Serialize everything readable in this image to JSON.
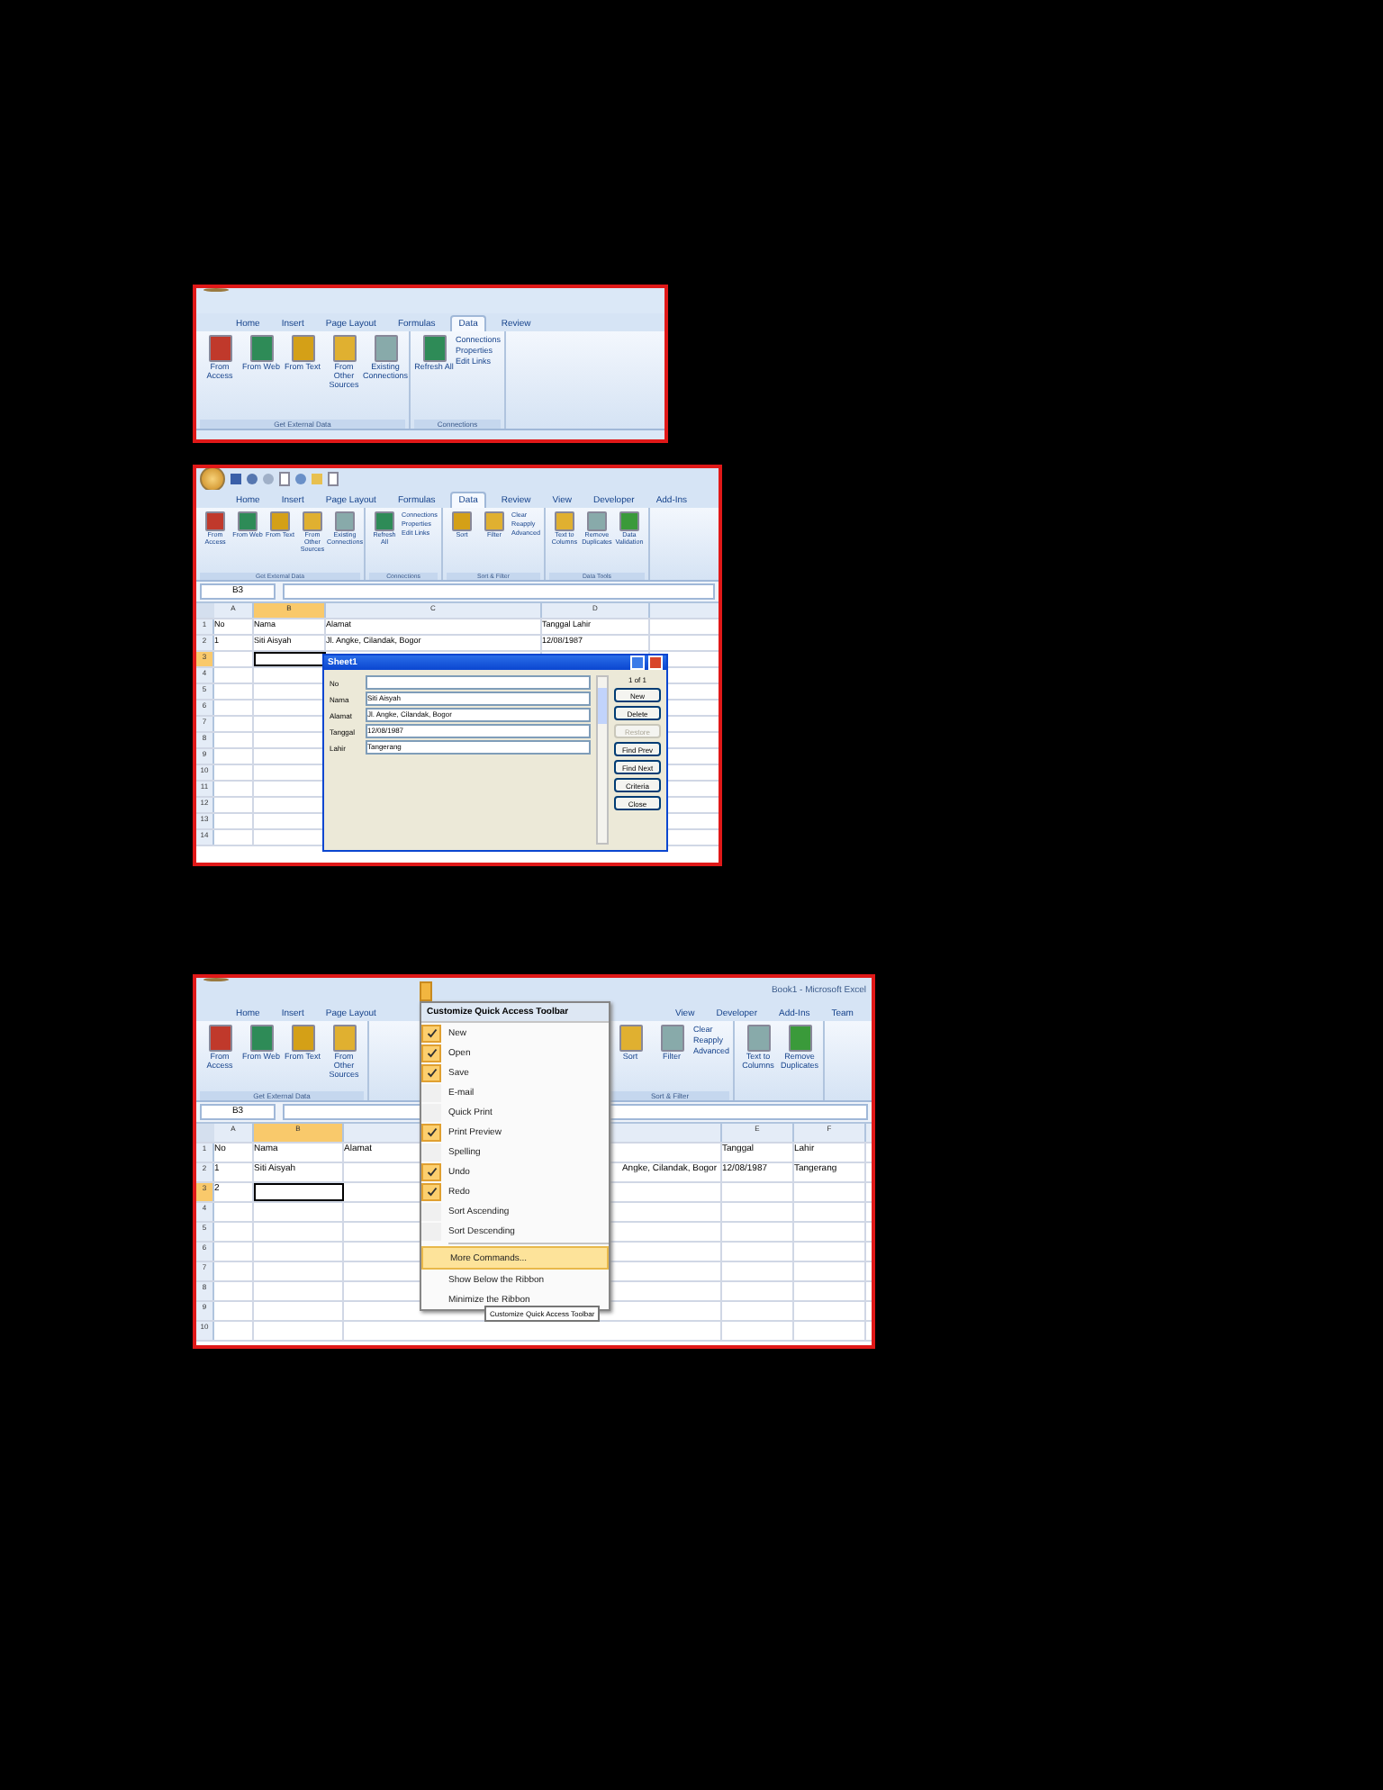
{
  "ribbon_shot": {
    "tabs": [
      {
        "label": "Home",
        "selected": false
      },
      {
        "label": "Insert",
        "selected": false
      },
      {
        "label": "Page Layout",
        "selected": false
      },
      {
        "label": "Formulas",
        "selected": false
      },
      {
        "label": "Data",
        "selected": true
      },
      {
        "label": "Review",
        "selected": false
      }
    ],
    "groups": [
      {
        "label": "Get External Data",
        "buttons": [
          "From Access",
          "From Web",
          "From Text",
          "From Other Sources",
          "Existing Connections"
        ]
      },
      {
        "label": "Connections",
        "buttons": [
          "Refresh All"
        ],
        "small": [
          "Connections",
          "Properties",
          "Edit Links"
        ]
      }
    ]
  },
  "form_shot": {
    "tabs": [
      {
        "label": "Home",
        "selected": false
      },
      {
        "label": "Insert",
        "selected": false
      },
      {
        "label": "Page Layout",
        "selected": false
      },
      {
        "label": "Formulas",
        "selected": false
      },
      {
        "label": "Data",
        "selected": true
      },
      {
        "label": "Review",
        "selected": false
      },
      {
        "label": "View",
        "selected": false
      },
      {
        "label": "Developer",
        "selected": false
      },
      {
        "label": "Add-Ins",
        "selected": false
      }
    ],
    "groups": [
      {
        "label": "Get External Data",
        "buttons": [
          "From Access",
          "From Web",
          "From Text",
          "From Other Sources",
          "Existing Connections"
        ]
      },
      {
        "label": "Connections",
        "buttons": [
          "Refresh All"
        ],
        "small": [
          "Connections",
          "Properties",
          "Edit Links"
        ]
      },
      {
        "label": "Sort & Filter",
        "buttons": [
          "Sort",
          "Filter"
        ],
        "small": [
          "Clear",
          "Reapply",
          "Advanced"
        ]
      },
      {
        "label": "Data Tools",
        "buttons": [
          "Text to Columns",
          "Remove Duplicates",
          "Data Validation"
        ]
      }
    ],
    "name_box": "B3",
    "columns": [
      {
        "label": "A",
        "selected": false
      },
      {
        "label": "B",
        "selected": true
      },
      {
        "label": "C",
        "selected": false
      },
      {
        "label": "D",
        "selected": false
      }
    ],
    "rows": [
      {
        "header": "1",
        "selected": false,
        "cells": [
          "No",
          "Nama",
          "Alamat",
          "Tanggal Lahir"
        ]
      },
      {
        "header": "2",
        "selected": false,
        "cells": [
          "1",
          "Siti Aisyah",
          "Jl. Angke, Cilandak, Bogor",
          "12/08/1987"
        ]
      },
      {
        "header": "3",
        "selected": true,
        "cells": [
          null,
          null,
          null,
          null
        ]
      },
      {
        "header": "4",
        "selected": false,
        "cells": [
          null,
          null,
          null,
          null
        ]
      },
      {
        "header": "5",
        "selected": false,
        "cells": [
          null,
          null,
          null,
          null
        ]
      },
      {
        "header": "6",
        "selected": false,
        "cells": [
          null,
          null,
          null,
          null
        ]
      },
      {
        "header": "7",
        "selected": false,
        "cells": [
          null,
          null,
          null,
          null
        ]
      },
      {
        "header": "8",
        "selected": false,
        "cells": [
          null,
          null,
          null,
          null
        ]
      },
      {
        "header": "9",
        "selected": false,
        "cells": [
          null,
          null,
          null,
          null
        ]
      },
      {
        "header": "10",
        "selected": false,
        "cells": [
          null,
          null,
          null,
          null
        ]
      },
      {
        "header": "11",
        "selected": false,
        "cells": [
          null,
          null,
          null,
          null
        ]
      },
      {
        "header": "12",
        "selected": false,
        "cells": [
          null,
          null,
          null,
          null
        ]
      },
      {
        "header": "13",
        "selected": false,
        "cells": [
          null,
          null,
          null,
          null
        ]
      },
      {
        "header": "14",
        "selected": false,
        "cells": [
          null,
          null,
          null,
          null
        ]
      }
    ],
    "dialog": {
      "title": "Sheet1",
      "record": "1 of 1",
      "fields": [
        {
          "label": "No"
        },
        {
          "label": "Nama",
          "value": "Siti Aisyah"
        },
        {
          "label": "Alamat",
          "value": "Jl. Angke, Cilandak, Bogor"
        },
        {
          "label": "Tanggal",
          "value": "12/08/1987"
        },
        {
          "label": "Lahir",
          "value": "Tangerang"
        }
      ],
      "buttons": [
        {
          "label": "New",
          "disabled": false
        },
        {
          "label": "Delete",
          "disabled": false
        },
        {
          "label": "Restore",
          "disabled": true
        },
        {
          "label": "Find Prev",
          "disabled": false
        },
        {
          "label": "Find Next",
          "disabled": false
        },
        {
          "label": "Criteria",
          "disabled": false
        },
        {
          "label": "Close",
          "disabled": false
        }
      ]
    }
  },
  "menu_shot": {
    "window_title": "Book1 - Microsoft Excel",
    "tabs": [
      {
        "label": "Home",
        "selected": false
      },
      {
        "label": "Insert",
        "selected": false
      },
      {
        "label": "Page Layout",
        "selected": false
      }
    ],
    "tabs_right": [
      {
        "label": "View",
        "selected": false
      },
      {
        "label": "Developer",
        "selected": false
      },
      {
        "label": "Add-Ins",
        "selected": false
      },
      {
        "label": "Team",
        "selected": false
      }
    ],
    "left_group": {
      "label": "Get External Data",
      "buttons": [
        "From Access",
        "From Web",
        "From Text",
        "From Other Sources"
      ]
    },
    "right_group": {
      "label": "Sort & Filter",
      "buttons": [
        "Sort",
        "Filter"
      ],
      "small": [
        "Clear",
        "Reapply",
        "Advanced"
      ]
    },
    "tools_buttons": [
      "Text to Columns",
      "Remove Duplicates"
    ],
    "name_box": "B3",
    "columns": [
      {
        "label": "A",
        "selected": false
      },
      {
        "label": "B",
        "selected": true
      },
      {
        "selected": false
      },
      {
        "label": "E",
        "selected": false
      },
      {
        "label": "F",
        "selected": false
      }
    ],
    "rows": [
      {
        "header": "1",
        "selected": false,
        "cells": [
          "No",
          "Nama",
          "Alamat",
          "Tanggal",
          "Lahir"
        ]
      },
      {
        "header": "2",
        "selected": false,
        "cells": [
          "1",
          "Siti Aisyah",
          null,
          "12/08/1987",
          "Tangerang"
        ]
      },
      {
        "header": "3",
        "selected": true,
        "cells": [
          "2",
          null,
          null,
          null,
          null
        ]
      },
      {
        "header": "4",
        "selected": false,
        "cells": [
          null,
          null,
          null,
          null,
          null
        ]
      },
      {
        "header": "5",
        "selected": false,
        "cells": [
          null,
          null,
          null,
          null,
          null
        ]
      },
      {
        "header": "6",
        "selected": false,
        "cells": [
          null,
          null,
          null,
          null,
          null
        ]
      },
      {
        "header": "7",
        "selected": false,
        "cells": [
          null,
          null,
          null,
          null,
          null
        ]
      },
      {
        "header": "8",
        "selected": false,
        "cells": [
          null,
          null,
          null,
          null,
          null
        ]
      },
      {
        "header": "9",
        "selected": false,
        "cells": [
          null,
          null,
          null,
          null,
          null
        ]
      },
      {
        "header": "10",
        "selected": false,
        "cells": [
          null,
          null,
          null,
          null,
          null
        ]
      }
    ],
    "overflow_text": "Angke, Cilandak, Bogor",
    "menu": {
      "title": "Customize Quick Access Toolbar",
      "items": [
        {
          "label": "New",
          "checked": true,
          "selected": false
        },
        {
          "label": "Open",
          "checked": true,
          "selected": false
        },
        {
          "label": "Save",
          "checked": true,
          "selected": false
        },
        {
          "label": "E-mail",
          "checked": false,
          "selected": false
        },
        {
          "label": "Quick Print",
          "checked": false,
          "selected": false
        },
        {
          "label": "Print Preview",
          "checked": true,
          "selected": false
        },
        {
          "label": "Spelling",
          "checked": false,
          "selected": false
        },
        {
          "label": "Undo",
          "checked": true,
          "selected": false
        },
        {
          "label": "Redo",
          "checked": true,
          "selected": false
        },
        {
          "label": "Sort Ascending",
          "checked": false,
          "selected": false
        },
        {
          "label": "Sort Descending",
          "checked": false,
          "selected": false
        }
      ],
      "commands": [
        {
          "label": "More Commands...",
          "selected": true
        },
        {
          "label": "Show Below the Ribbon",
          "selected": false
        },
        {
          "label": "Minimize the Ribbon",
          "selected": false
        }
      ],
      "tooltip": "Customize Quick Access Toolbar"
    }
  }
}
